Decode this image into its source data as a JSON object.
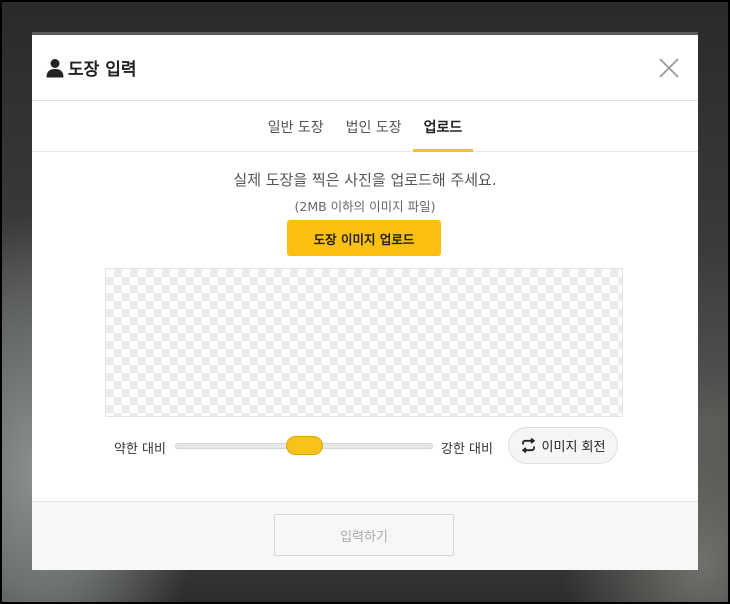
{
  "modal": {
    "title": "도장 입력",
    "title_icon": "user-icon",
    "close_icon": "close-icon"
  },
  "tabs": [
    {
      "label": "일반 도장",
      "active": false
    },
    {
      "label": "법인 도장",
      "active": false
    },
    {
      "label": "업로드",
      "active": true
    }
  ],
  "upload": {
    "instruction": "실제 도장을 찍은 사진을 업로드해 주세요.",
    "sub_instruction": "(2MB 이하의 이미지 파일)",
    "button_label": "도장 이미지 업로드"
  },
  "contrast": {
    "weak_label": "약한 대비",
    "strong_label": "강한 대비",
    "level": 0.5
  },
  "rotate": {
    "label": "이미지 회전",
    "icon": "rotate-icon"
  },
  "footer": {
    "submit_label": "입력하기",
    "submit_enabled": false
  },
  "colors": {
    "accent": "#fcc012",
    "tab_underline": "#f5c518"
  }
}
